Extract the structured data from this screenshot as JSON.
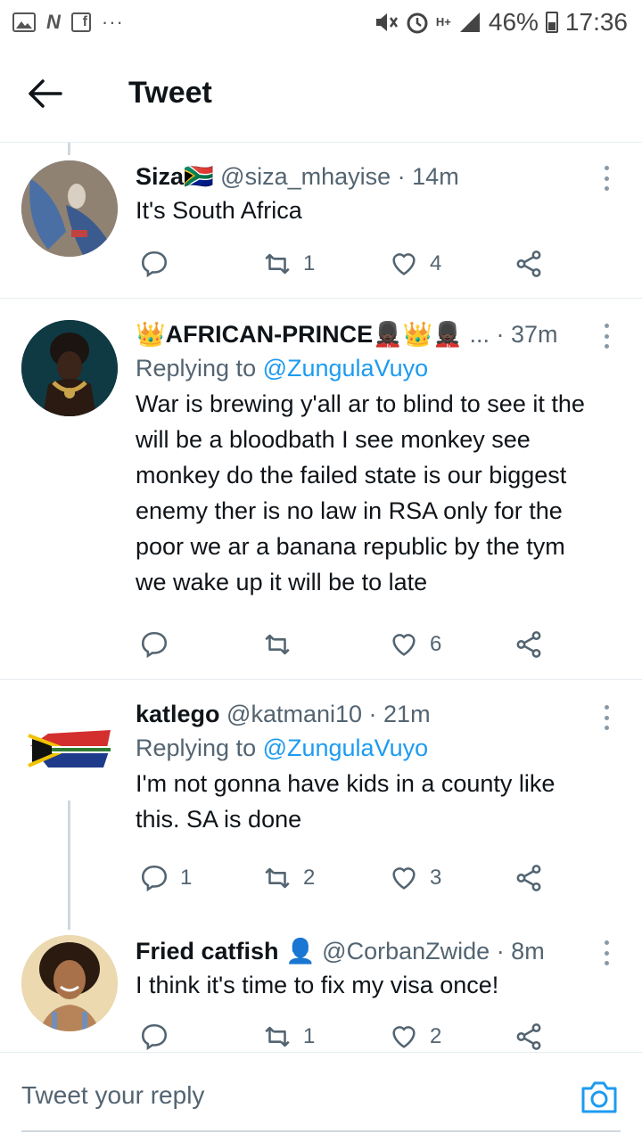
{
  "status_bar": {
    "battery": "46%",
    "time": "17:36",
    "network": "H+",
    "left_icons": [
      "gallery-icon",
      "n-icon",
      "facebook-icon",
      "more-dots-icon"
    ]
  },
  "header": {
    "title": "Tweet"
  },
  "tweets": [
    {
      "name": "Siza🇿🇦",
      "handle": "@siza_mhayise",
      "time": "· 14m",
      "replying_to": "",
      "text": "It's South Africa",
      "replies": "",
      "retweets": "1",
      "likes": "4"
    },
    {
      "name": "👑AFRICAN-PRINCE💂🏿👑💂🏿",
      "handle": "...",
      "time": "· 37m",
      "replying_prefix": "Replying to ",
      "replying_to": "@ZungulaVuyo",
      "text": "War is brewing y'all ar to blind to see it the will be a bloodbath I see monkey see monkey do the failed state is our biggest enemy ther is no law in RSA only for the poor we ar a banana republic by the tym we wake up it will be to late",
      "replies": "",
      "retweets": "",
      "likes": "6"
    },
    {
      "name": "katlego",
      "handle": "@katmani10",
      "time": "· 21m",
      "replying_prefix": "Replying to ",
      "replying_to": "@ZungulaVuyo",
      "text": "I'm not gonna have kids in a county like this. SA is done",
      "replies": "1",
      "retweets": "2",
      "likes": "3"
    },
    {
      "name": "Fried catfish 👤",
      "handle": "@CorbanZwide",
      "time": "· 8m",
      "replying_to": "",
      "text": "I think it's time to fix my visa once!",
      "replies": "",
      "retweets": "1",
      "likes": "2"
    }
  ],
  "reply_bar": {
    "placeholder": "Tweet your reply"
  },
  "colors": {
    "accent": "#1d9bf0",
    "muted": "#536471",
    "text": "#0f1419",
    "divider": "#e6ecf0"
  }
}
